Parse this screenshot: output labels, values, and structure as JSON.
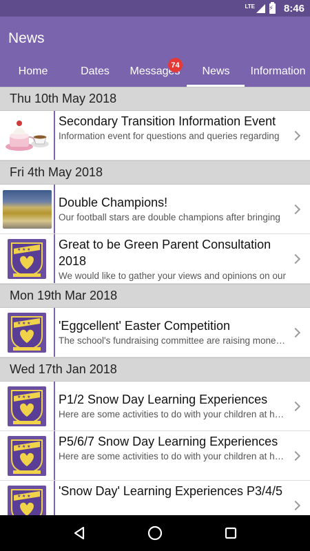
{
  "status_bar": {
    "network": "LTE",
    "time": "8:46"
  },
  "app": {
    "title": "News"
  },
  "tabs": [
    {
      "label": "Home"
    },
    {
      "label": "Dates"
    },
    {
      "label": "Messages",
      "badge": "74"
    },
    {
      "label": "News",
      "active": true
    },
    {
      "label": "Information"
    }
  ],
  "sections": [
    {
      "date": "Thu 10th May 2018",
      "items": [
        {
          "title": "Secondary Transition Information Event",
          "summary": "Information event for questions and queries regarding",
          "thumb": "teacup-icon"
        }
      ]
    },
    {
      "date": "Fri 4th May 2018",
      "items": [
        {
          "title": "Double Champions!",
          "summary": "Our football stars are double champions after bringing",
          "thumb": "team-photo"
        },
        {
          "title": "Great to be Green Parent Consultation 2018",
          "summary": "We would like to gather your views and opinions on our",
          "thumb": "school-crest-icon"
        }
      ]
    },
    {
      "date": "Mon 19th Mar 2018",
      "items": [
        {
          "title": "'Eggcellent' Easter Competition",
          "summary": "The school's fundraising committee are raising money for",
          "thumb": "school-crest-icon"
        }
      ]
    },
    {
      "date": "Wed 17th Jan 2018",
      "items": [
        {
          "title": "P1/2 Snow Day Learning Experiences",
          "summary": "Here are some activities to do with your children at home",
          "thumb": "school-crest-icon"
        },
        {
          "title": "P5/6/7 Snow Day Learning Experiences",
          "summary": "Here are some activities to do with your children at home",
          "thumb": "school-crest-icon"
        },
        {
          "title": "'Snow Day' Learning Experiences P3/4/5",
          "summary": "",
          "thumb": "school-crest-icon"
        }
      ]
    }
  ],
  "nav": {
    "back": "back-icon",
    "home": "home-icon",
    "recents": "recents-icon"
  },
  "colors": {
    "primary": "#7a64ae",
    "status": "#5e4c8c",
    "badge": "#e53935",
    "header_bg": "#d6d6d6"
  }
}
